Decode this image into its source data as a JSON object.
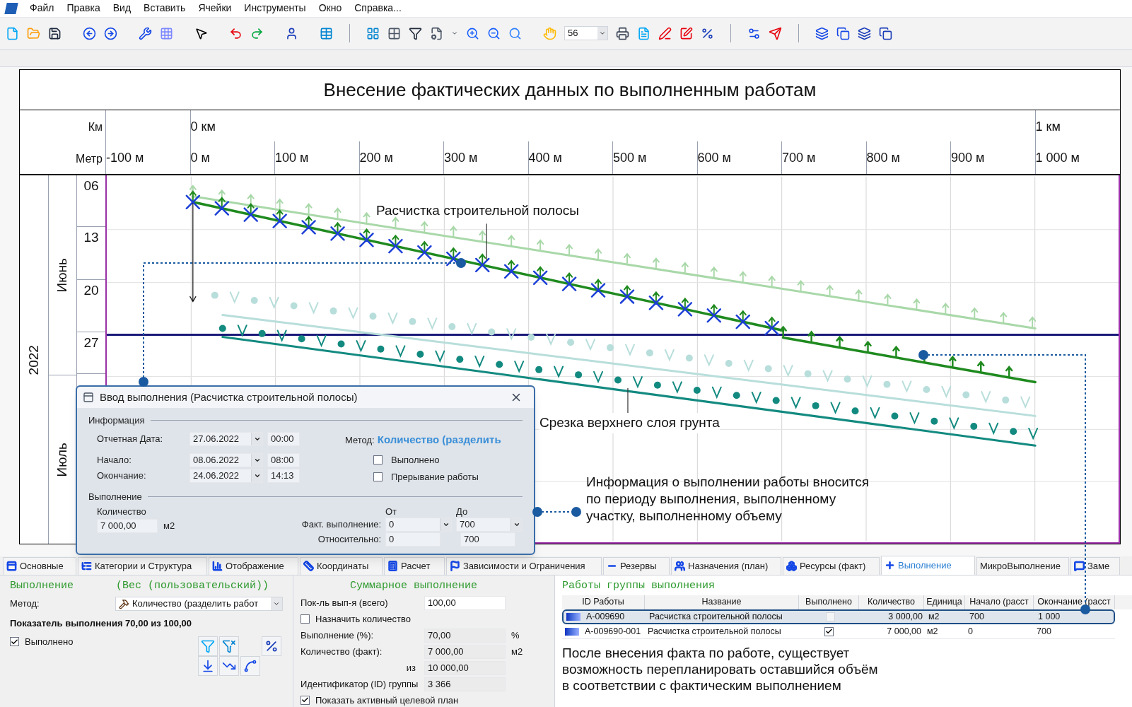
{
  "menu": [
    "Файл",
    "Правка",
    "Вид",
    "Вставить",
    "Ячейки",
    "Инструменты",
    "Окно",
    "Справка..."
  ],
  "toolbar": {
    "zoom": "56"
  },
  "diagram": {
    "title": "Внесение фактических данных по выполненным работам",
    "km_label": "Км",
    "km_ticks": [
      "0 км",
      "1 км"
    ],
    "metre_label": "Метр",
    "metre_ticks": [
      "-100 м",
      "0 м",
      "100 м",
      "200 м",
      "300 м",
      "400 м",
      "500 м",
      "600 м",
      "700 м",
      "800 м",
      "900 м",
      "1 000 м"
    ],
    "year": "2022",
    "months": [
      "Июнь",
      "Июль"
    ],
    "weeks": [
      "06",
      "13",
      "20",
      "27"
    ],
    "labels": [
      "Расчистка строительной полосы",
      "Срезка верхнего слоя грунта"
    ]
  },
  "dialog": {
    "title": "Ввод выполнения (Расчистка строительной полосы)",
    "info_heading": "Информация",
    "dates": [
      {
        "label": "Отчетная Дата:",
        "date": "27.06.2022",
        "time": "00:00"
      },
      {
        "label": "Начало:",
        "date": "08.06.2022",
        "time": "08:00"
      },
      {
        "label": "Окончание:",
        "date": "24.06.2022",
        "time": "14:13"
      }
    ],
    "method_label": "Метод:",
    "method": "Количество (разделить",
    "checks": [
      {
        "label": "Выполнено",
        "checked": false
      },
      {
        "label": "Прерывание работы",
        "checked": false
      }
    ],
    "exec_heading": "Выполнение",
    "quantity_label": "Количество",
    "quantity": "7 000,00",
    "unit": "м2",
    "from_label": "От",
    "to_label": "До",
    "actual_label": "Факт. выполнение:",
    "actual_from": "0",
    "actual_to": "700",
    "relative_label": "Относительно:",
    "relative_from": "0",
    "relative_to": "700"
  },
  "annotation": "Информация о выполнении работы вносится по периоду выполнения, выполненному участку, выполненному объему",
  "tabs": [
    {
      "label": "Основные",
      "selected": false
    },
    {
      "label": "Категории и Структура",
      "selected": false
    },
    {
      "label": "Отображение",
      "selected": false
    },
    {
      "label": "Координаты",
      "selected": false
    },
    {
      "label": "Расчет",
      "selected": false
    },
    {
      "label": "Зависимости и Ограничения",
      "selected": false
    },
    {
      "label": "Резервы",
      "selected": false
    },
    {
      "label": "Назначения (план)",
      "selected": false
    },
    {
      "label": "Ресурсы (факт)",
      "selected": false
    },
    {
      "label": "Выполнение",
      "selected": true
    },
    {
      "label": "МикроВыполнение",
      "selected": false
    },
    {
      "label": "Заме",
      "selected": false
    }
  ],
  "execution": {
    "heading": "Выполнение",
    "weight": "(Вес (пользовательский))",
    "method_label": "Метод:",
    "method": "Количество (разделить работ",
    "indicator": "Показатель выполнения 70,00 из 100,00",
    "completed": {
      "label": "Выполнено",
      "checked": true
    }
  },
  "summary": {
    "heading": "Суммарное выполнение",
    "total_label": "Пок-ль вып-я (всего)",
    "total": "100,00",
    "assign": {
      "label": "Назначить количество",
      "checked": false
    },
    "rows": [
      {
        "label": "Выполнение (%):",
        "value": "70,00",
        "unit": "%"
      },
      {
        "label": "Количество (факт):",
        "value": "7 000,00",
        "unit": "м2"
      },
      {
        "label": "из",
        "value": "10 000,00"
      },
      {
        "label": "Идентификатор (ID) группы",
        "value": "3 366"
      }
    ],
    "show_plan": {
      "label": "Показать активный целевой план",
      "checked": true
    }
  },
  "group_works": {
    "heading": "Работы группы выполнения",
    "columns": [
      "ID Работы",
      "Название",
      "Выполнено",
      "Количество",
      "Единица",
      "Начало (расст",
      "Окончание (расст"
    ],
    "rows": [
      {
        "id": "A-009690",
        "name": "Расчистка строительной полосы",
        "completed": false,
        "quantity": "3 000,00",
        "unit": "м2",
        "start": "700",
        "finish": "1 000",
        "selected": true
      },
      {
        "id": "A-009690-001",
        "name": "Расчистка строительной полосы",
        "completed": true,
        "quantity": "7 000,00",
        "unit": "м2",
        "start": "0",
        "finish": "700",
        "selected": false
      }
    ],
    "note": "После внесения факта по работе, существует возможность перепланировать оставшийся объём в соответствии с фактическим выполнением"
  }
}
